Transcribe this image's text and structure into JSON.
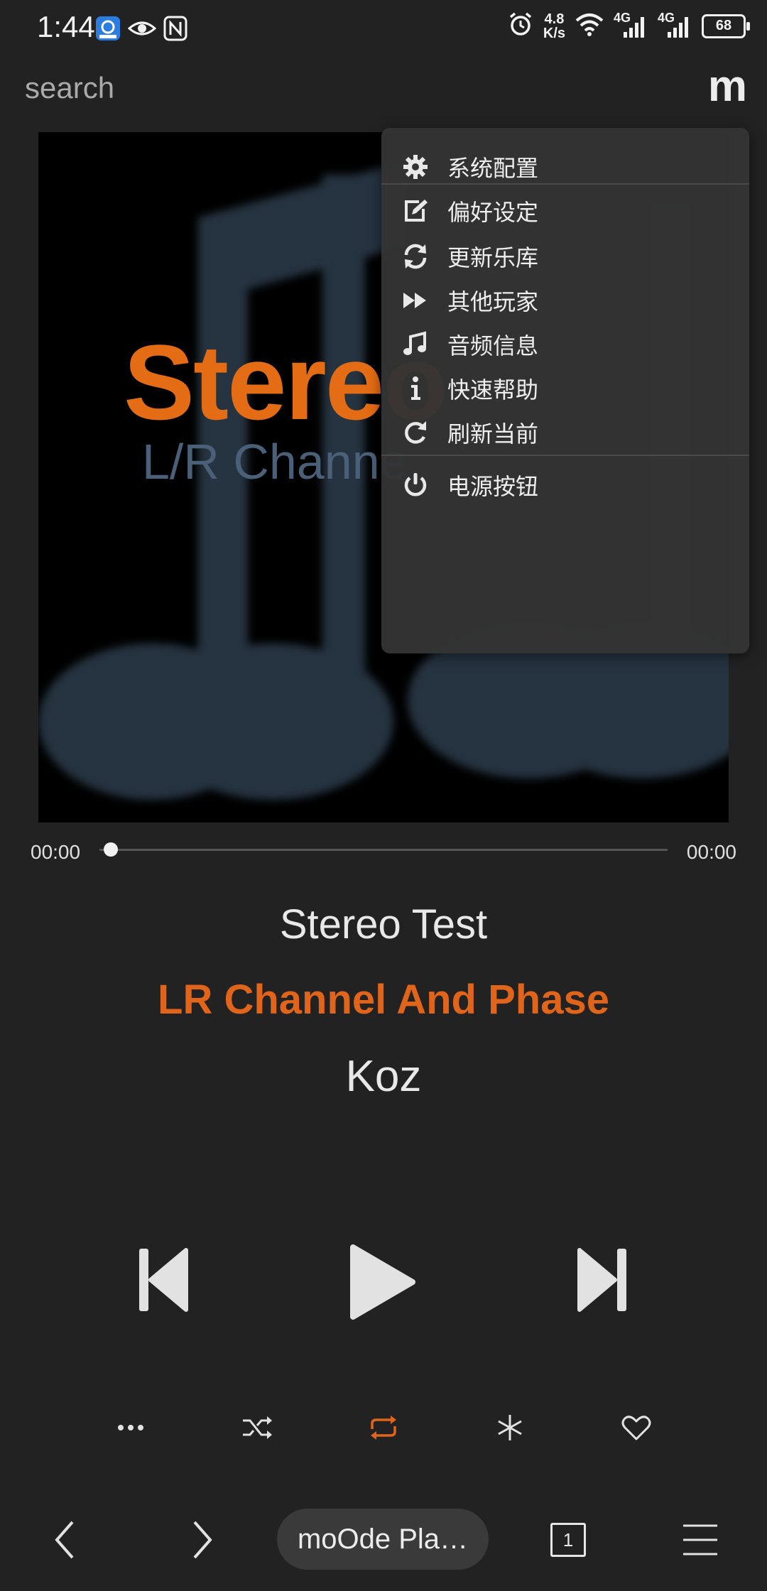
{
  "status_bar": {
    "time": "1:44",
    "speed_value": "4.8",
    "speed_unit": "K/s",
    "net_badge_1": "4G",
    "net_badge_2": "4G",
    "battery": "68"
  },
  "header": {
    "search_placeholder": "search",
    "logo": "m"
  },
  "cover": {
    "title": "Stereo",
    "subtitle": "L/R Channe"
  },
  "menu": {
    "items": [
      {
        "label": "系统配置",
        "icon": "gear-icon"
      },
      {
        "label": "偏好设定",
        "icon": "edit-icon"
      },
      {
        "label": "更新乐库",
        "icon": "refresh-icon"
      },
      {
        "label": "其他玩家",
        "icon": "fast-forward-icon"
      },
      {
        "label": "音频信息",
        "icon": "music-note-icon"
      },
      {
        "label": "快速帮助",
        "icon": "info-icon"
      },
      {
        "label": "刷新当前",
        "icon": "redo-icon"
      },
      {
        "label": "电源按钮",
        "icon": "power-icon"
      }
    ]
  },
  "progress": {
    "elapsed": "00:00",
    "total": "00:00",
    "fraction": 0
  },
  "song": {
    "title": "Stereo Test",
    "album": "LR Channel And Phase",
    "artist": "Koz"
  },
  "bottom_nav": {
    "player_name": "moOde Pla…",
    "queue_count": "1"
  },
  "colors": {
    "accent": "#e0641a",
    "background": "#222222",
    "menu_bg": "#343434"
  }
}
